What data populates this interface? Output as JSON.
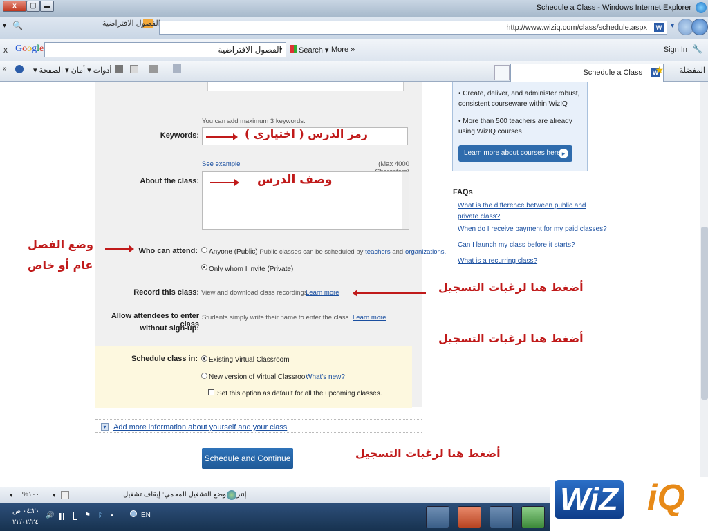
{
  "window": {
    "title": "Schedule a Class - Windows Internet Explorer",
    "close_label": "x",
    "max_label": "▢",
    "min_label": "▬"
  },
  "address": {
    "url": "http://www.wiziq.com/class/schedule.aspx",
    "site_icon": "W",
    "tab_link": "الفصول الافتراضية"
  },
  "google": {
    "close": "x",
    "logo": "Google",
    "query": "الفصول الافتراضية",
    "search_label": "Search",
    "more_label": "More",
    "signin": "Sign In"
  },
  "toolbar": {
    "items": "أدوات ▾  أمان ▾  الصفحة ▾",
    "tab_title": "Schedule a Class",
    "favorites": "المفضلة"
  },
  "sidebar": {
    "bullets": [
      "Create, deliver, and administer robust, consistent courseware within WizIQ",
      "More than 500 teachers are already using WizIQ courses"
    ],
    "learn_button": "Learn more about courses here",
    "faq_title": "FAQs",
    "faqs": [
      "What is the difference between public and private class?",
      "When do I receive payment for my paid classes?",
      "Can I launch my class before it starts?",
      "What is a recurring class?"
    ]
  },
  "form": {
    "keywords_hint": "You can add maximum 3 keywords.",
    "keywords_label": "Keywords:",
    "see_example": "See example",
    "max_chars": "(Max 4000 Characters)",
    "about_label": "About the class:",
    "who_label": "Who can attend:",
    "public_option": "Anyone (Public)",
    "public_note_pre": "Public classes can be scheduled by",
    "public_teachers": "teachers",
    "public_and": "and",
    "public_orgs": "organizations.",
    "private_option": "Only whom I invite (Private)",
    "record_label": "Record this class:",
    "record_text": "View and download class recordings.",
    "learn_more": "Learn more",
    "allow_label_1": "Allow attendees to enter class",
    "allow_label_2": "without sign-up:",
    "allow_text": "Students simply write their name to enter the class.",
    "schedule_in_label": "Schedule class in:",
    "existing_option": "Existing Virtual Classroom",
    "new_option": "New version of Virtual Classroom",
    "whats_new": "What's new?",
    "default_option": "Set this option as default for all the upcoming classes.",
    "more_info": "Add more information about yourself and your class",
    "submit": "Schedule and Continue"
  },
  "annotations": {
    "keywords": "رمز الدرس ( اختياري )",
    "about": "وصف الدرس",
    "mode_1": "وضع الفصل",
    "mode_2": "عام أو خاص",
    "register_1": "أضغط هنا لرغبات التسجيل",
    "register_2": "أضغط هنا لرغبات التسجيل",
    "register_3": "أضغط هنا لرغبات التسجيل"
  },
  "status": {
    "zone": "إنترنت  وضع التشغيل المحمي: إيقاف تشغيل",
    "zoom": "%١٠٠"
  },
  "taskbar": {
    "time": "٠٤:٢٠ ص",
    "date": "٢٢/٠٢/٢٤",
    "lang": "EN"
  },
  "logo": {
    "wiz": "WiZ",
    "iq": "iQ"
  }
}
